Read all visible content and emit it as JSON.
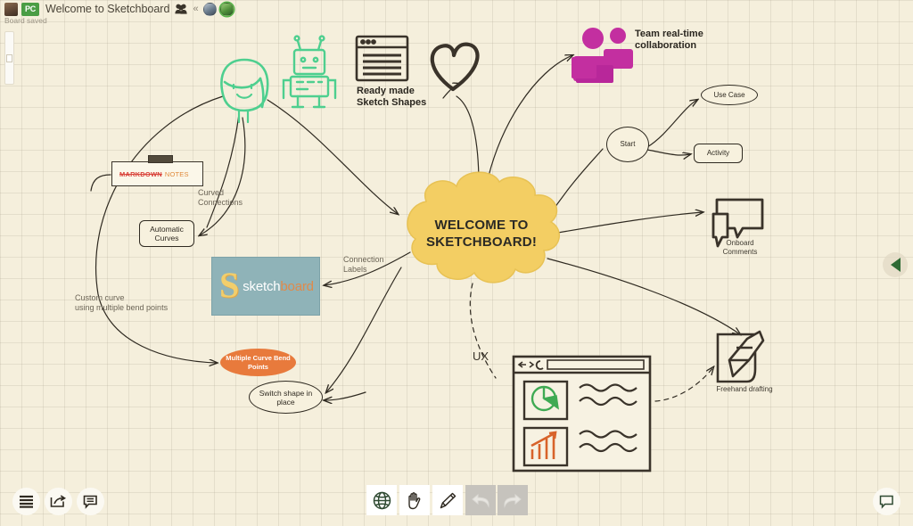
{
  "topbar": {
    "title": "Welcome to Sketchboard",
    "pc_badge": "PC",
    "chevron": "«",
    "status": "Board saved",
    "people_icon": "people-icon",
    "avatars": [
      "avatar-user-1",
      "avatar-user-2"
    ]
  },
  "canvas": {
    "center_node": {
      "line1": "WELCOME TO",
      "line2": "SKETCHBOARD!",
      "fill": "#f3ce63",
      "stroke": "#e8c254"
    },
    "markdown_note": {
      "strikethrough_text": "MARKDOWN",
      "text": "NOTES",
      "strike_color": "#d9443b",
      "text_color": "#e08a3c"
    },
    "automatic_curves": "Automatic\nCurves",
    "curved_connections_label": "Curved\nConnections",
    "connection_labels_label": "Connection\nLabels",
    "custom_curve_label": "Custom curve\nusing multiple bend points",
    "bend_points": "Multiple Curve\nBend Points",
    "bend_points_color": "#e87a3c",
    "switch_shape": "Switch shape\nin place",
    "sketchboard_logo": {
      "mark": "S",
      "word_part1": "sketch",
      "word_part2": "board",
      "bg": "#8fb3b8"
    },
    "ready_made": "Ready made\nSketch Shapes",
    "team_collab": "Team real-time\ncollaboration",
    "team_collab_color": "#c32fa0",
    "flowchart": {
      "start": "Start",
      "use_case": "Use Case",
      "activity": "Activity"
    },
    "onboard_comments": "Onboard\nComments",
    "freehand_drafting": "Freehand drafting",
    "ux_label": "UX",
    "robot_icon": "robot-icon",
    "robot_color": "#4ecf8f",
    "girl_icon": "girl-face-icon",
    "heart_icon": "heart-icon",
    "browser_icon": "browser-window-icon",
    "wireframe": {
      "pie_color": "#3faa53",
      "bar_color": "#d8632a"
    }
  },
  "toolbar": {
    "left": [
      {
        "name": "menu-button",
        "icon": "menu-lines-icon"
      },
      {
        "name": "share-button",
        "icon": "share-export-icon"
      },
      {
        "name": "comments-button",
        "icon": "comment-bubble-icon"
      }
    ],
    "center": [
      {
        "name": "globe-button",
        "icon": "globe-icon",
        "disabled": false
      },
      {
        "name": "hand-button",
        "icon": "hand-icon",
        "disabled": false
      },
      {
        "name": "pencil-button",
        "icon": "pencil-icon",
        "disabled": false
      },
      {
        "name": "undo-button",
        "icon": "undo-arrow-icon",
        "disabled": true
      },
      {
        "name": "redo-button",
        "icon": "redo-arrow-icon",
        "disabled": true
      }
    ],
    "right": [
      {
        "name": "help-button",
        "icon": "help-comment-icon"
      }
    ]
  },
  "controls": {
    "zoom_slider": "zoom-slider",
    "panel_toggle": "collapse-panel-toggle"
  }
}
